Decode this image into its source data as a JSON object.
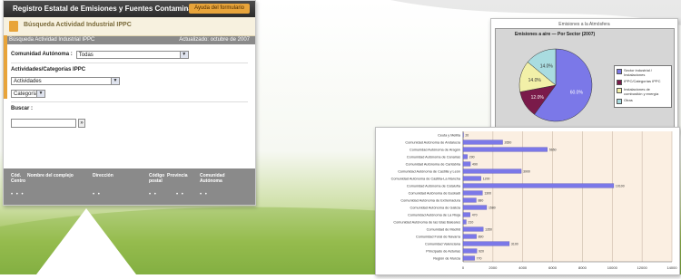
{
  "app": {
    "title": "Registro Estatal de Emisiones y Fuentes Contaminantes",
    "help_label": "Ayuda del formulario",
    "section_title": "Búsqueda Actividad Industrial IPPC",
    "band_left": "Búsqueda Actividad Industrial IPPC",
    "band_right": "Actualizado: octubre de 2007"
  },
  "form": {
    "ccaa_label": "Comunidad Autónoma :",
    "ccaa_value": "Todas",
    "activity_label": "Actividades/Categorías IPPC",
    "activity_value": "Actividades",
    "category_value": "Categorías",
    "search_label": "Buscar :",
    "search_value": "",
    "go_label": "»"
  },
  "table": {
    "columns": [
      "Cód. Centro",
      "Nombre del complejo",
      "Dirección",
      "Código postal",
      "Provincia",
      "Comunidad Autónoma"
    ],
    "row": [
      "• • •",
      "",
      "• •",
      "• •",
      "• •",
      "• •"
    ]
  },
  "pie_window": {
    "header": "Emisiones a la Atmósfera",
    "subtitle": "Emisiones a aire — Por Sector (2007)",
    "legend": [
      "Sector industrial / Instalaciones",
      "IPPC/Categorías IPPC",
      "Instalaciones de combustión y energía",
      "Otras"
    ],
    "colors": [
      "#7b78e8",
      "#7a1a4a",
      "#f2f0a8",
      "#a9dce0"
    ]
  },
  "chart_data": [
    {
      "type": "pie",
      "title": "Emisiones a aire — Por Sector (2007)",
      "labels": [
        "Sector industrial / Instalaciones",
        "IPPC/Categorías IPPC",
        "Instalaciones de combustión y energía",
        "Otras"
      ],
      "values": [
        60,
        12,
        14,
        14
      ],
      "slice_labels": [
        "60.0%",
        "12.0%",
        "14.0%",
        "14.0%"
      ],
      "colors": [
        "#7b78e8",
        "#7a1a4a",
        "#f2f0a8",
        "#a9dce0"
      ],
      "legend": "right"
    },
    {
      "type": "bar",
      "orientation": "horizontal",
      "categories": [
        "Ceuta y Melilla",
        "Comunidad Autónoma de Andalucía",
        "Comunidad Autónoma de Aragón",
        "Comunidad Autónoma de Canarias",
        "Comunidad Autónoma de Cantabria",
        "Comunidad Autónoma de Castilla y León",
        "Comunidad Autónoma de Castilla-La Mancha",
        "Comunidad Autónoma de Cataluña",
        "Comunidad Autónoma de Euskadi",
        "Comunidad Autónoma de Extremadura",
        "Comunidad Autónoma de Galicia",
        "Comunidad Autónoma de La Rioja",
        "Comunidad Autónoma de las Islas Baleares",
        "Comunidad de Madrid",
        "Comunidad Foral de Navarra",
        "Comunidad Valenciana",
        "Principado de Asturias",
        "Región de Murcia"
      ],
      "values": [
        20,
        2650,
        5650,
        290,
        490,
        3900,
        1200,
        10100,
        1300,
        880,
        1580,
        470,
        210,
        1350,
        890,
        3100,
        920,
        770
      ],
      "value_labels": [
        "20",
        "2650",
        "5650",
        "290",
        "490",
        "3900",
        "1200",
        "10100",
        "1300",
        "880",
        "1580",
        "470",
        "210",
        "1350",
        "890",
        "3100",
        "920",
        "770"
      ],
      "xlim": [
        0,
        14000
      ],
      "xticks": [
        0,
        2000,
        4000,
        6000,
        8000,
        10000,
        12000,
        14000
      ],
      "color": "#7b78e8",
      "grid": true
    }
  ]
}
